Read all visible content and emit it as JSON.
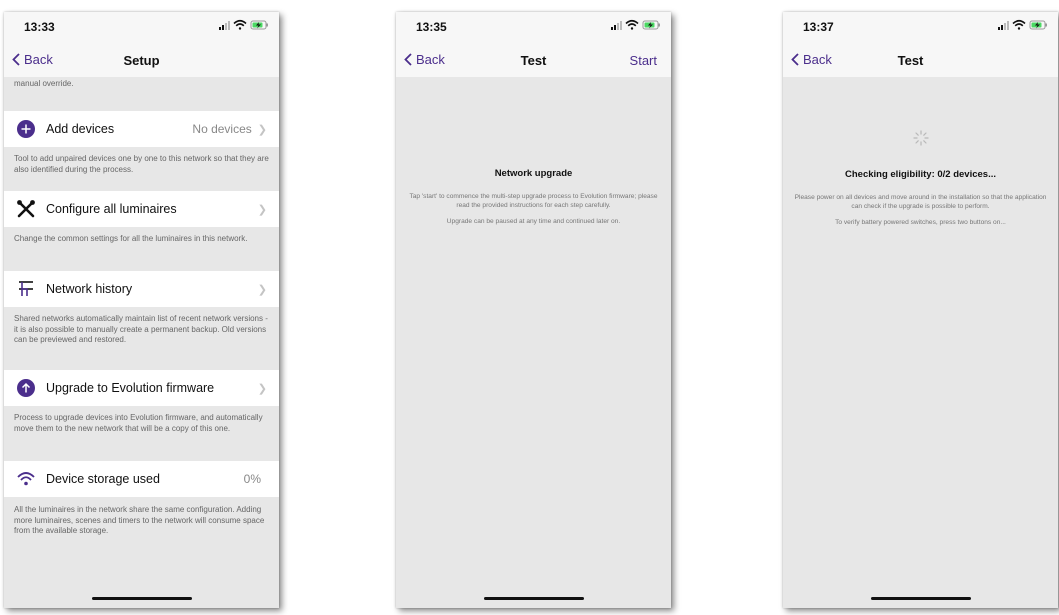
{
  "screens": {
    "setup": {
      "time": "13:33",
      "back": "Back",
      "title": "Setup",
      "intro": "manual override.",
      "rows": [
        {
          "label": "Add devices",
          "value": "No devices",
          "icon": "plus-circle-icon",
          "desc": "Tool to add unpaired devices one by one to this network so that they are also identified during the process."
        },
        {
          "label": "Configure all luminaires",
          "value": "",
          "icon": "tools-icon",
          "desc": "Change the common settings for all the luminaires in this network."
        },
        {
          "label": "Network history",
          "value": "",
          "icon": "history-icon",
          "desc": "Shared networks automatically maintain list of recent network versions - it is also possible to manually create a permanent backup. Old versions can be previewed and restored."
        },
        {
          "label": "Upgrade to Evolution firmware",
          "value": "",
          "icon": "upgrade-arrow-icon",
          "desc": "Process to upgrade devices into Evolution firmware, and automatically move them to the new network that will be a copy of this one."
        },
        {
          "label": "Device storage used",
          "value": "0%",
          "icon": "wifi-icon",
          "desc": "All the luminaires in the network share the same configuration. Adding more luminaires, scenes and timers to the network will consume space from the available storage."
        }
      ]
    },
    "test_start": {
      "time": "13:35",
      "back": "Back",
      "title": "Test",
      "action": "Start",
      "heading": "Network upgrade",
      "text1": "Tap 'start' to commence the multi-step upgrade process to Evolution firmware; please read the provided instructions for each step carefully.",
      "text2": "Upgrade can be paused at any time and continued later on."
    },
    "test_check": {
      "time": "13:37",
      "back": "Back",
      "title": "Test",
      "heading": "Checking eligibility: 0/2 devices...",
      "text1": "Please power on all devices and move around in the installation so that the application can check if the upgrade is possible to perform.",
      "text2": "To verify battery powered switches, press two buttons on..."
    }
  },
  "colors": {
    "accent": "#4b2e8c",
    "background": "#e7e7e7",
    "row": "#ffffff",
    "secondary_text": "#666666"
  }
}
